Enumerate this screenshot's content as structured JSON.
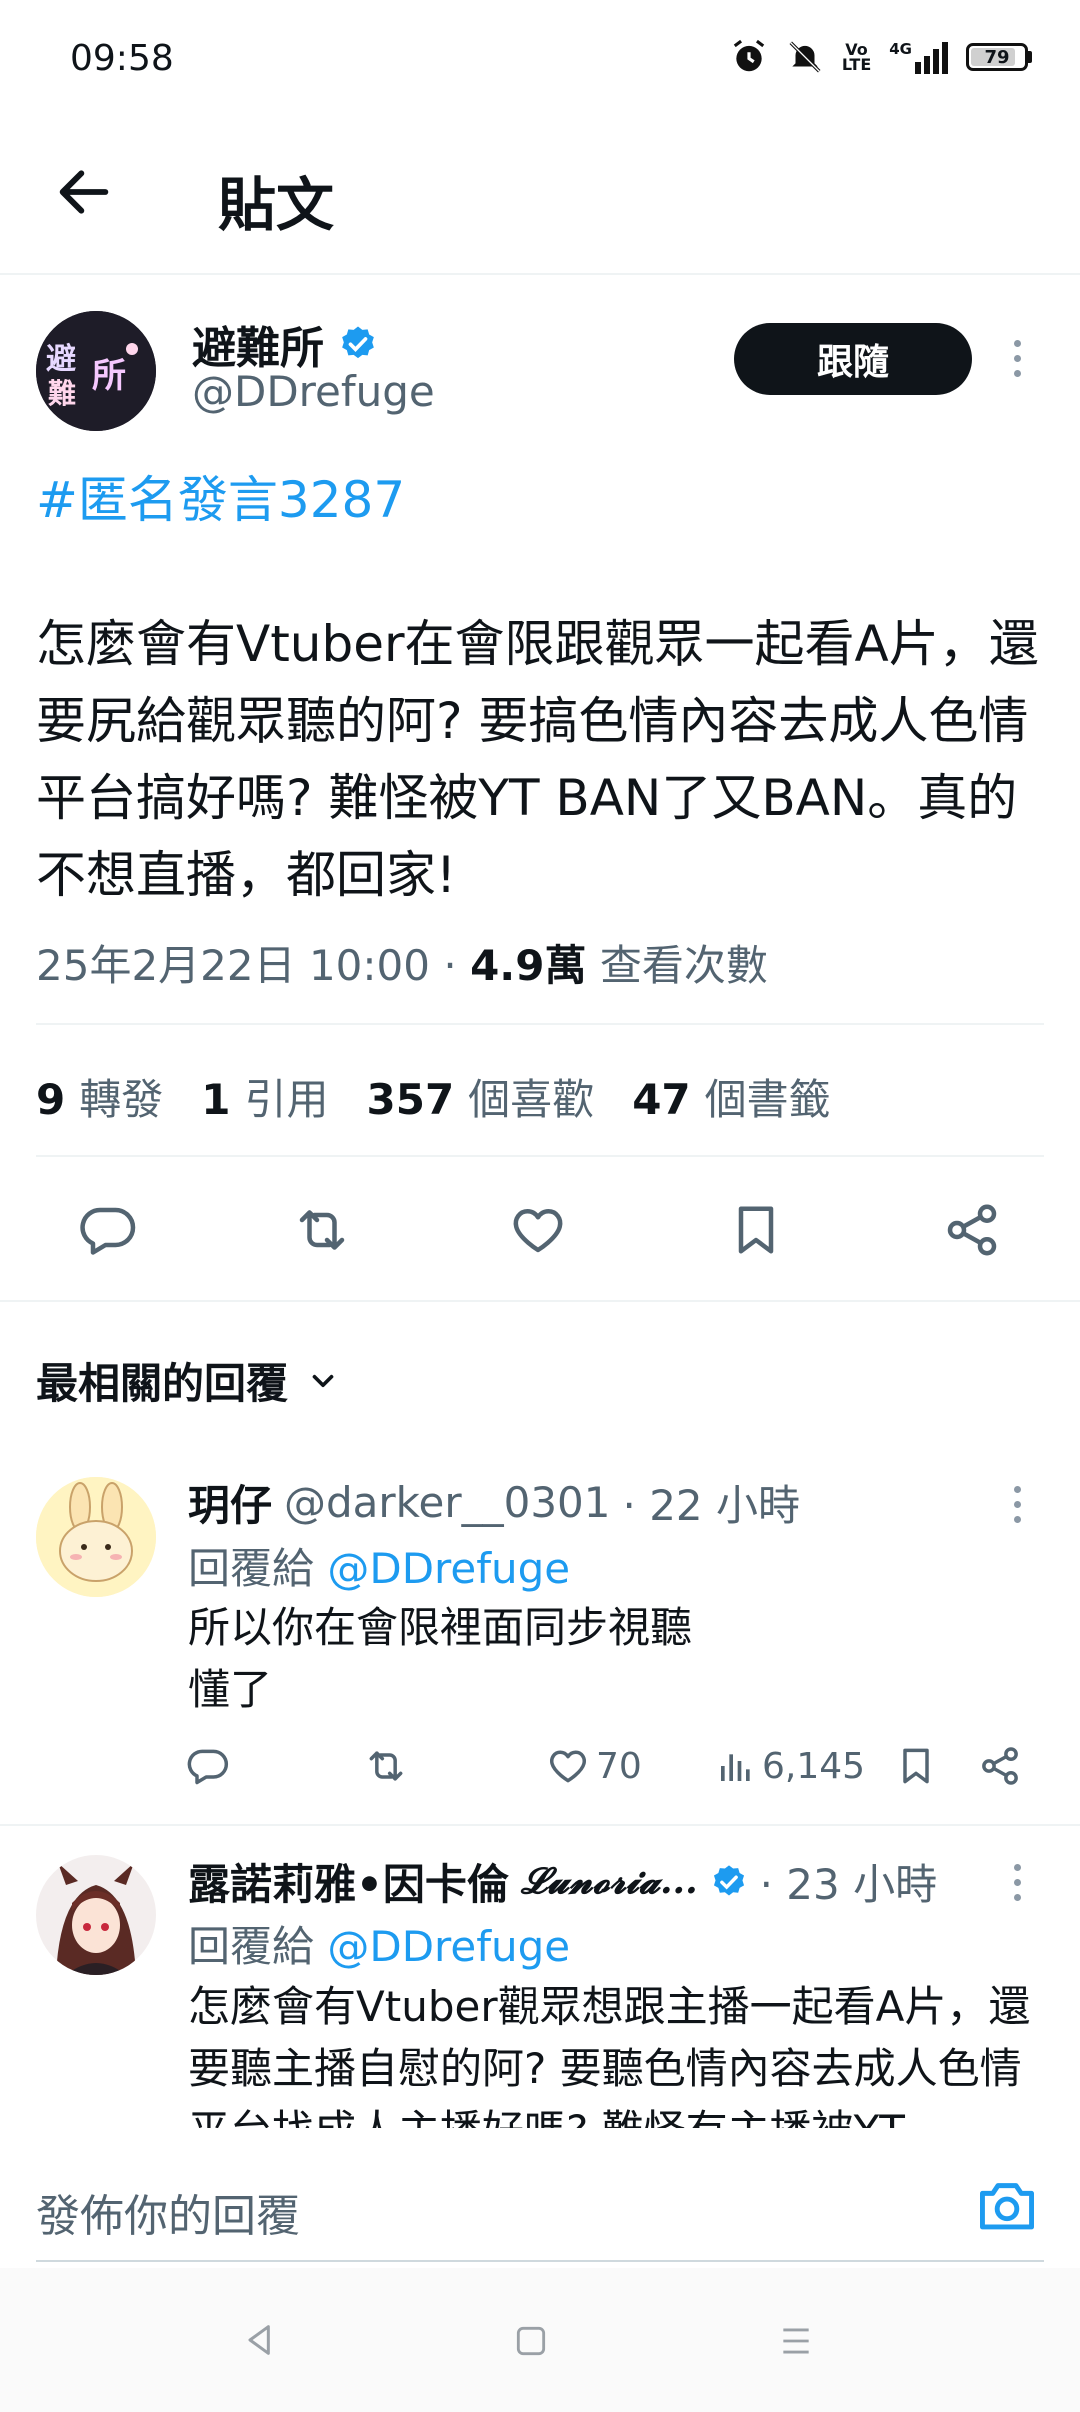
{
  "status_bar": {
    "time": "09:58",
    "battery": "79",
    "network": "4G"
  },
  "header": {
    "title": "貼文"
  },
  "post": {
    "author_name": "避難所",
    "author_handle": "@DDrefuge",
    "follow_label": "跟隨",
    "hashtag": "#匿名發言3287",
    "body": "怎麼會有Vtuber在會限跟觀眾一起看A片，還要尻給觀眾聽的阿? 要搞色情內容去成人色情平台搞好嗎? 難怪被YT BAN了又BAN。真的不想直播，都回家!",
    "timestamp": "25年2月22日 10:00",
    "meta_sep": " · ",
    "view_count": "4.9萬",
    "view_label": "查看次數",
    "stats": [
      {
        "count": "9",
        "label": "轉發"
      },
      {
        "count": "1",
        "label": "引用"
      },
      {
        "count": "357",
        "label": "個喜歡"
      },
      {
        "count": "47",
        "label": "個書籤"
      }
    ]
  },
  "replies_section": {
    "sort_label": "最相關的回覆"
  },
  "replies": [
    {
      "name": "玥仔",
      "handle": "@darker__0301",
      "time": "· 22 小時",
      "reply_to_label": "回覆給",
      "reply_to_handle": "@DDrefuge",
      "text": "所以你在會限裡面同步視聽\n懂了",
      "likes": "70",
      "views": "6,145"
    },
    {
      "name": "露諾莉雅•因卡倫",
      "name_script": "𝓛𝓾𝓷𝓸𝓻𝓲𝓪...",
      "time": "· 23 小時",
      "reply_to_label": "回覆給",
      "reply_to_handle": "@DDrefuge",
      "text": "怎麼會有Vtuber觀眾想跟主播一起看A片，還要聽主播自慰的阿? 要聽色情內容去成人色情平台找成人主播好嗎? 難怪有主播被YT"
    }
  ],
  "compose": {
    "placeholder": "發佈你的回覆"
  },
  "colors": {
    "accent": "#1d9bf0",
    "text": "#0f1419",
    "secondary": "#536471"
  }
}
